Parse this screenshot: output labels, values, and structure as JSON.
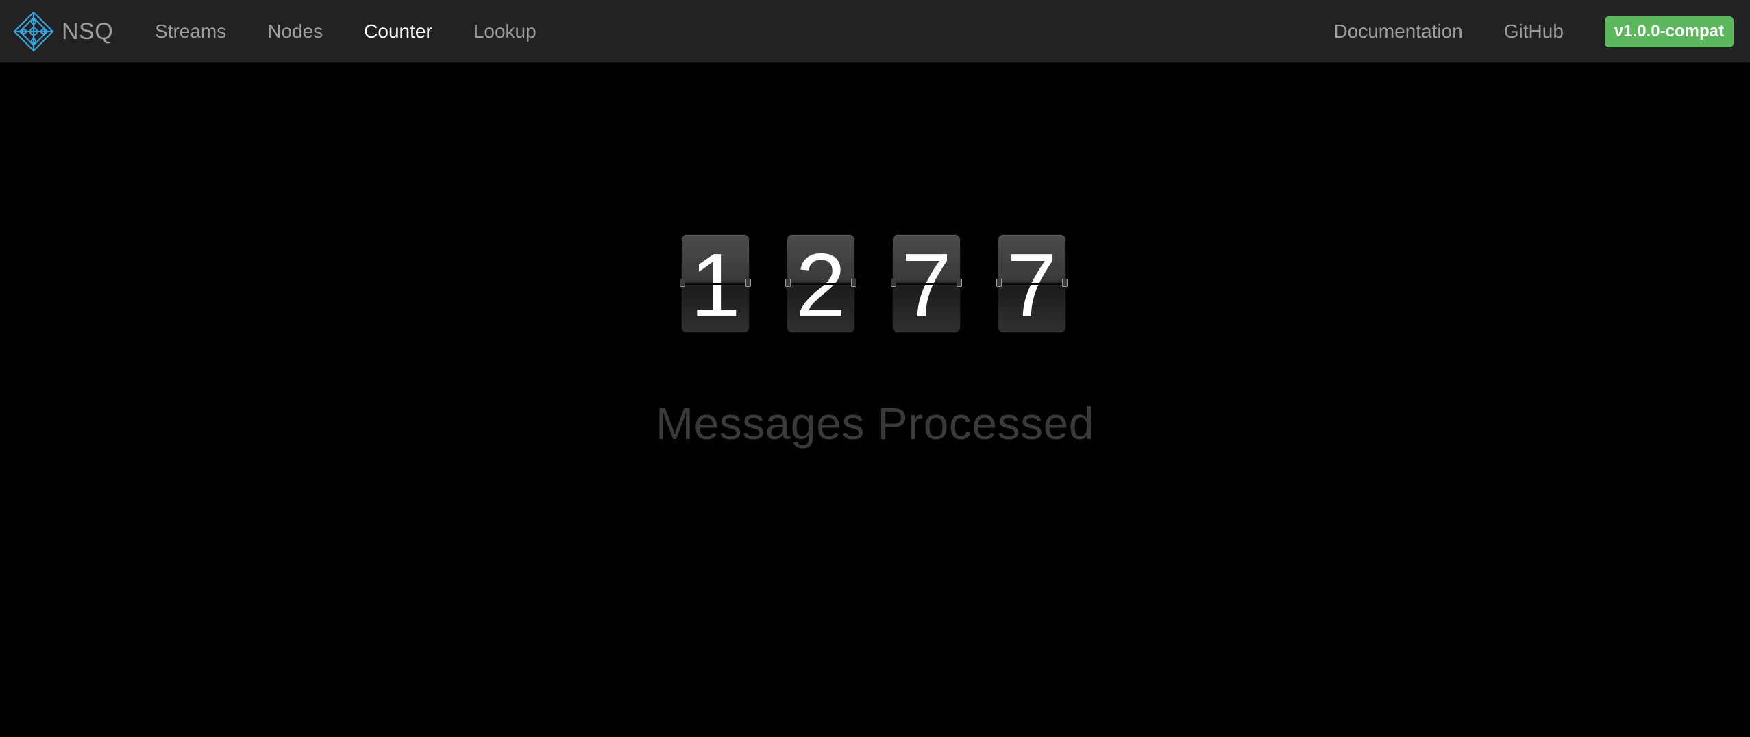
{
  "navbar": {
    "brand": "NSQ",
    "links_left": [
      {
        "label": "Streams",
        "active": false
      },
      {
        "label": "Nodes",
        "active": false
      },
      {
        "label": "Counter",
        "active": true
      },
      {
        "label": "Lookup",
        "active": false
      }
    ],
    "links_right": [
      {
        "label": "Documentation"
      },
      {
        "label": "GitHub"
      }
    ],
    "version": "v1.0.0-compat"
  },
  "counter": {
    "digits": [
      "1",
      "2",
      "7",
      "7"
    ],
    "caption": "Messages Processed"
  },
  "colors": {
    "navbar_bg": "#222222",
    "nav_text": "#9d9d9d",
    "nav_active_text": "#ffffff",
    "badge_green": "#5cb85c",
    "logo_blue": "#3ba3d8",
    "caption_text": "#3a3a3a"
  },
  "icons": {
    "logo": "nsq-diamond-logo-icon"
  }
}
